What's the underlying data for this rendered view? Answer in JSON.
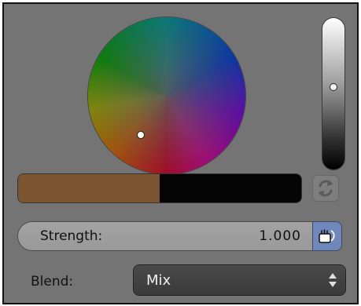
{
  "colors": {
    "panel_bg": "#747474",
    "primary_color": "#7a5530",
    "secondary_color": "#050505",
    "pressure_active": "#7087bb"
  },
  "color_wheel": {
    "cursor": "white-dot"
  },
  "value_slider": {
    "level": 0.55
  },
  "swatches": {
    "split": 0.5
  },
  "strength": {
    "label": "Strength:",
    "value": "1.000",
    "pressure_icon": "pressure-hand-icon"
  },
  "blend": {
    "label": "Blend:",
    "selected": "Mix",
    "icon": "updown-arrows-icon"
  },
  "switch": {
    "icon": "swap-colors-icon"
  }
}
